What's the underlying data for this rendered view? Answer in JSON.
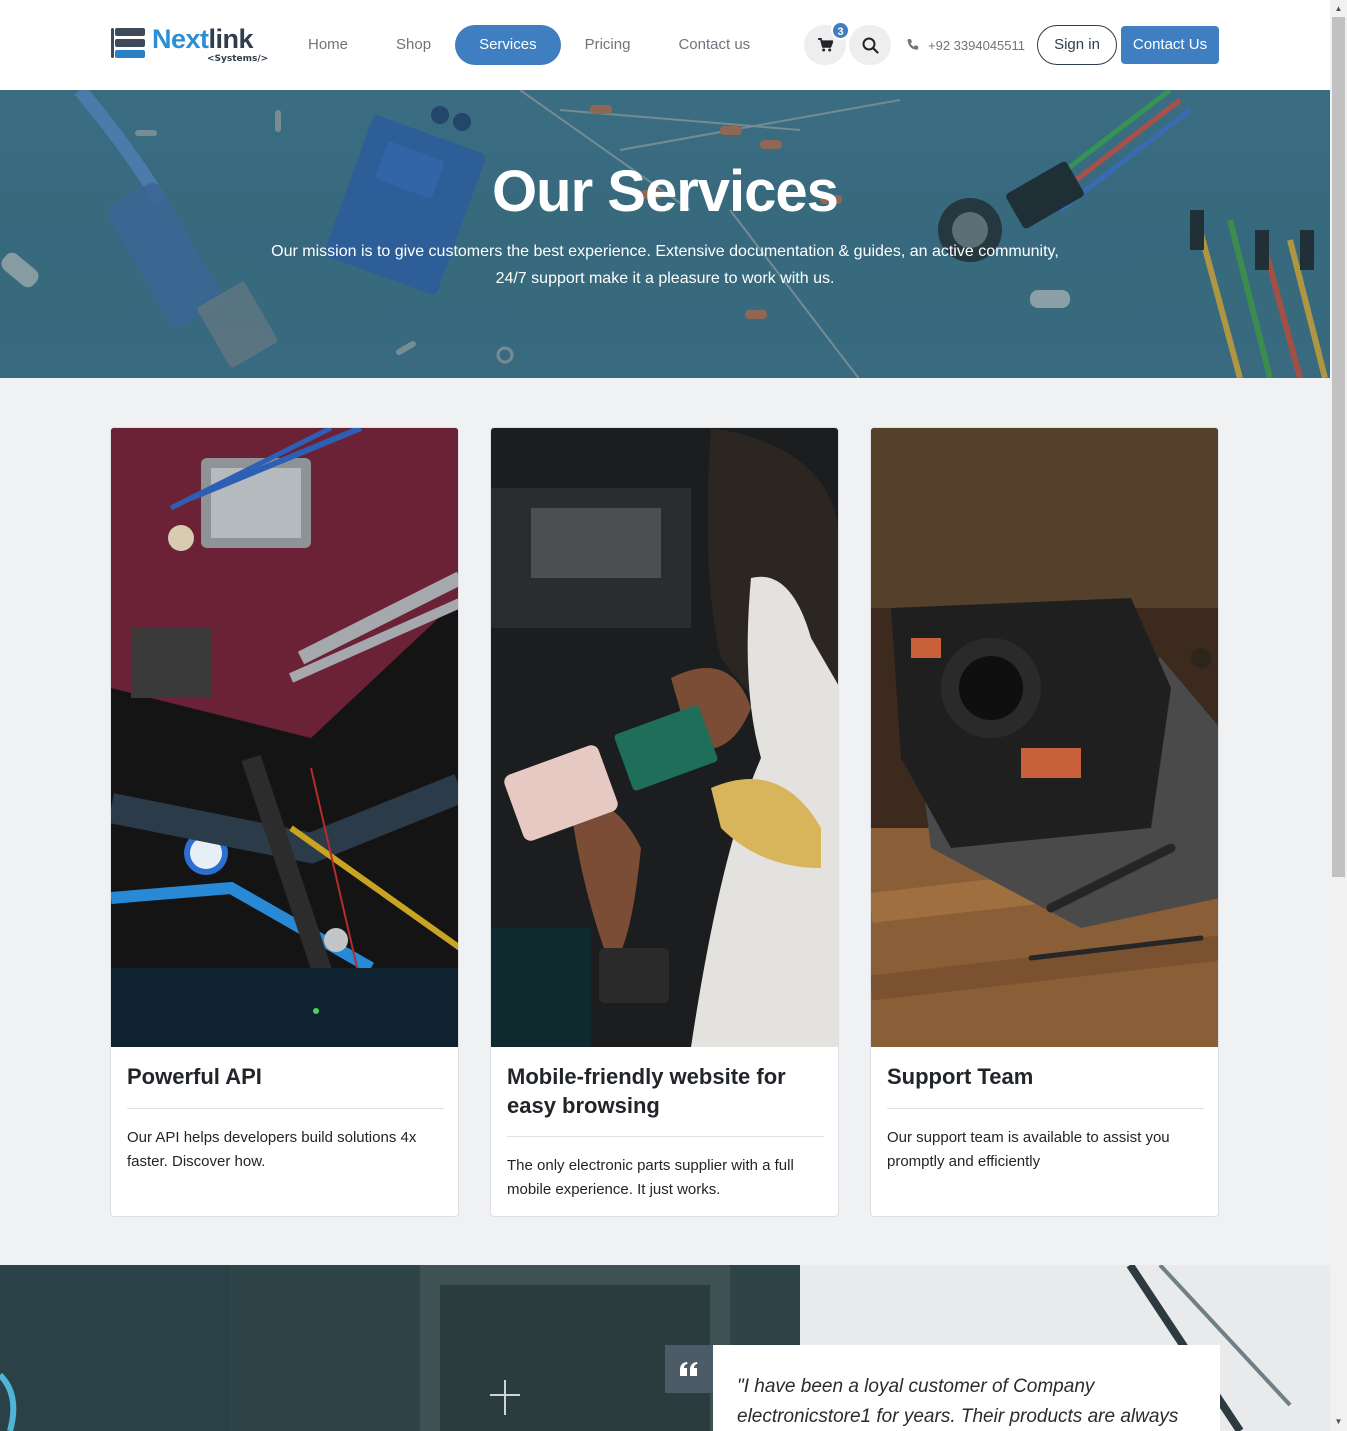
{
  "header": {
    "logo_main": "Next",
    "logo_accent": "link",
    "logo_sub": "<Systems/>",
    "nav": [
      {
        "label": "Home",
        "active": false
      },
      {
        "label": "Shop",
        "active": false
      },
      {
        "label": "Services",
        "active": true
      },
      {
        "label": "Pricing",
        "active": false
      },
      {
        "label": "Contact us",
        "active": false
      }
    ],
    "cart_count": "3",
    "phone": "+92 3394045511",
    "signin_label": "Sign in",
    "contact_label": "Contact Us"
  },
  "hero": {
    "title": "Our Services",
    "subtitle_line1": "Our mission is to give customers the best experience. Extensive documentation & guides, an active community,",
    "subtitle_line2": "24/7 support make it a pleasure to work with us."
  },
  "cards": [
    {
      "title": "Powerful API",
      "text": "Our API helps developers build solutions 4x faster. Discover how."
    },
    {
      "title": "Mobile-friendly website for easy browsing",
      "text": "The only electronic parts supplier with a full mobile experience. It just works."
    },
    {
      "title": "Support Team",
      "text": "Our support team is available to assist you promptly and efficiently"
    }
  ],
  "testimonial": {
    "quote": "\"I have been a loyal customer of Company electronicstore1 for years. Their products are always"
  },
  "colors": {
    "accent": "#3f7fc1",
    "dark": "#2f3d4c",
    "hero_bg": "#3c6d83"
  }
}
